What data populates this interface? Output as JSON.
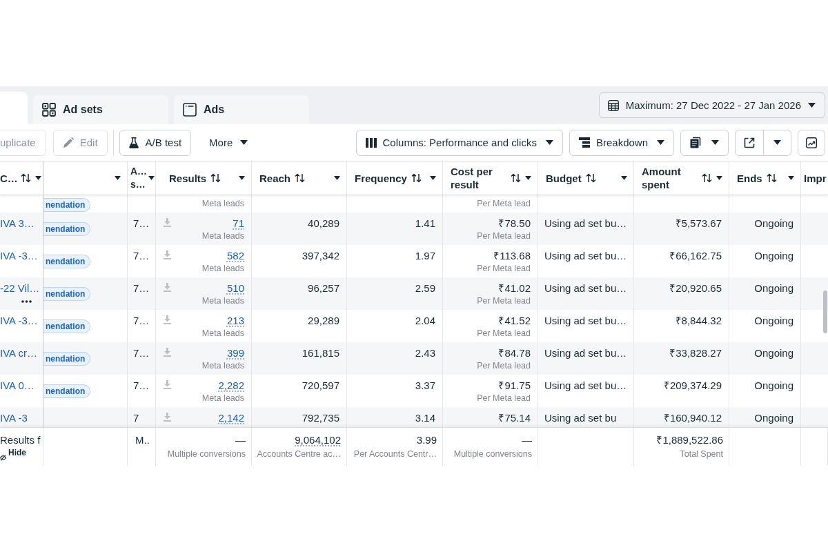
{
  "tabs": [
    {
      "selected": true
    },
    {
      "kind": "adsets",
      "label": "Ad sets",
      "selected": false
    },
    {
      "kind": "ads",
      "label": "Ads",
      "selected": false
    }
  ],
  "date_range": {
    "label": "Maximum: 27 Dec 2022 - 27 Jan 2026"
  },
  "toolbar": {
    "groups": [
      [
        {
          "kind": "duplicate",
          "label": "uplicate",
          "disabled": true
        },
        {
          "kind": "edit",
          "label": "Edit",
          "disabled": true
        }
      ],
      [
        {
          "kind": "abtest",
          "label": "A/B test",
          "disabled": false
        },
        {
          "kind": "more",
          "label": "More",
          "disabled": false
        }
      ]
    ],
    "right": [
      {
        "kind": "columns",
        "label": "Columns: Performance and clicks"
      },
      {
        "kind": "breakdown",
        "label": "Breakdown"
      },
      {
        "kind": "reports"
      },
      {
        "kind": "export"
      },
      {
        "kind": "chart"
      }
    ]
  },
  "table": {
    "columns": [
      {
        "label": "C…",
        "sortable": true,
        "menu": true
      },
      {
        "sortable": false,
        "menu": true
      },
      {
        "label": "A… s…",
        "sortable": false,
        "menu": true
      },
      {
        "label": "Results",
        "sortable": true,
        "menu": true
      },
      {
        "label": "Reach",
        "sortable": true,
        "menu": true
      },
      {
        "label": "Frequency",
        "sortable": true,
        "menu": true
      },
      {
        "label": "Cost per result",
        "sortable": true,
        "menu": true
      },
      {
        "label": "Budget",
        "sortable": true,
        "menu": true
      },
      {
        "label": "Amount spent",
        "sortable": true,
        "menu": true
      },
      {
        "label": "Ends",
        "sortable": true,
        "menu": true
      },
      {
        "label": "Impr",
        "sortable": false,
        "menu": false
      }
    ],
    "rows": [
      {
        "badge": "nendation",
        "results_sub": "Meta leads",
        "cost_sub": "Per Meta lead",
        "actions_visible": false
      },
      {
        "name": "IVA 3…",
        "badge": "nendation",
        "column_2": "7…",
        "results": "71",
        "results_sub": "Meta leads",
        "reach": "40,289",
        "frequency": "1.41",
        "cost": "₹78.50",
        "cost_sub": "Per Meta lead",
        "budget": "Using ad set bu…",
        "amount": "₹5,573.67",
        "ends": "Ongoing",
        "actions_visible": false
      },
      {
        "name": "IVA -3…",
        "badge": "nendation",
        "column_2": "7…",
        "results": "582",
        "results_sub": "Meta leads",
        "reach": "397,342",
        "frequency": "1.97",
        "cost": "₹113.68",
        "cost_sub": "Per Meta lead",
        "budget": "Using ad set bu…",
        "amount": "₹66,162.75",
        "ends": "Ongoing",
        "actions_visible": false
      },
      {
        "name": "-22 Vil…",
        "badge": "nendation",
        "column_2": "7…",
        "results": "510",
        "results_sub": "Meta leads",
        "reach": "96,257",
        "frequency": "2.59",
        "cost": "₹41.02",
        "cost_sub": "Per Meta lead",
        "budget": "Using ad set bu…",
        "amount": "₹20,920.65",
        "ends": "Ongoing",
        "actions_visible": true
      },
      {
        "name": "IVA -3…",
        "badge": "nendation",
        "column_2": "7…",
        "results": "213",
        "results_sub": "Meta leads",
        "reach": "29,289",
        "frequency": "2.04",
        "cost": "₹41.52",
        "cost_sub": "Per Meta lead",
        "budget": "Using ad set bu…",
        "amount": "₹8,844.32",
        "ends": "Ongoing",
        "actions_visible": false
      },
      {
        "name": "IVA cr…",
        "badge": "nendation",
        "column_2": "7…",
        "results": "399",
        "results_sub": "Meta leads",
        "reach": "161,815",
        "frequency": "2.43",
        "cost": "₹84.78",
        "cost_sub": "Per Meta lead",
        "budget": "Using ad set bu…",
        "amount": "₹33,828.27",
        "ends": "Ongoing",
        "actions_visible": false
      },
      {
        "name": "IVA 0…",
        "badge": "nendation",
        "column_2": "7…",
        "results": "2,282",
        "results_sub": "Meta leads",
        "reach": "720,597",
        "frequency": "3.37",
        "cost": "₹91.75",
        "cost_sub": "Per Meta lead",
        "budget": "Using ad set bu…",
        "amount": "₹209,374.29",
        "ends": "Ongoing",
        "actions_visible": false
      },
      {
        "name": "IVA -3",
        "column_2": "7",
        "results": "2,142",
        "reach": "792,735",
        "frequency": "3.14",
        "cost": "₹75.14",
        "budget": "Using ad set bu",
        "amount": "₹160,940.12",
        "ends": "Ongoing",
        "actions_visible": false
      }
    ],
    "footer": {
      "label": "Results f",
      "hide": "Hide",
      "column_2": "M..",
      "results": "—",
      "results_sub": "Multiple conversions",
      "reach": "9,064,102",
      "reach_sub": "Accounts Centre ac…",
      "frequency": "3.99",
      "frequency_sub": "Per Accounts Centr…",
      "cost": "—",
      "cost_sub": "Multiple conversions",
      "amount": "₹1,889,522.86",
      "amount_sub": "Total Spent"
    }
  }
}
